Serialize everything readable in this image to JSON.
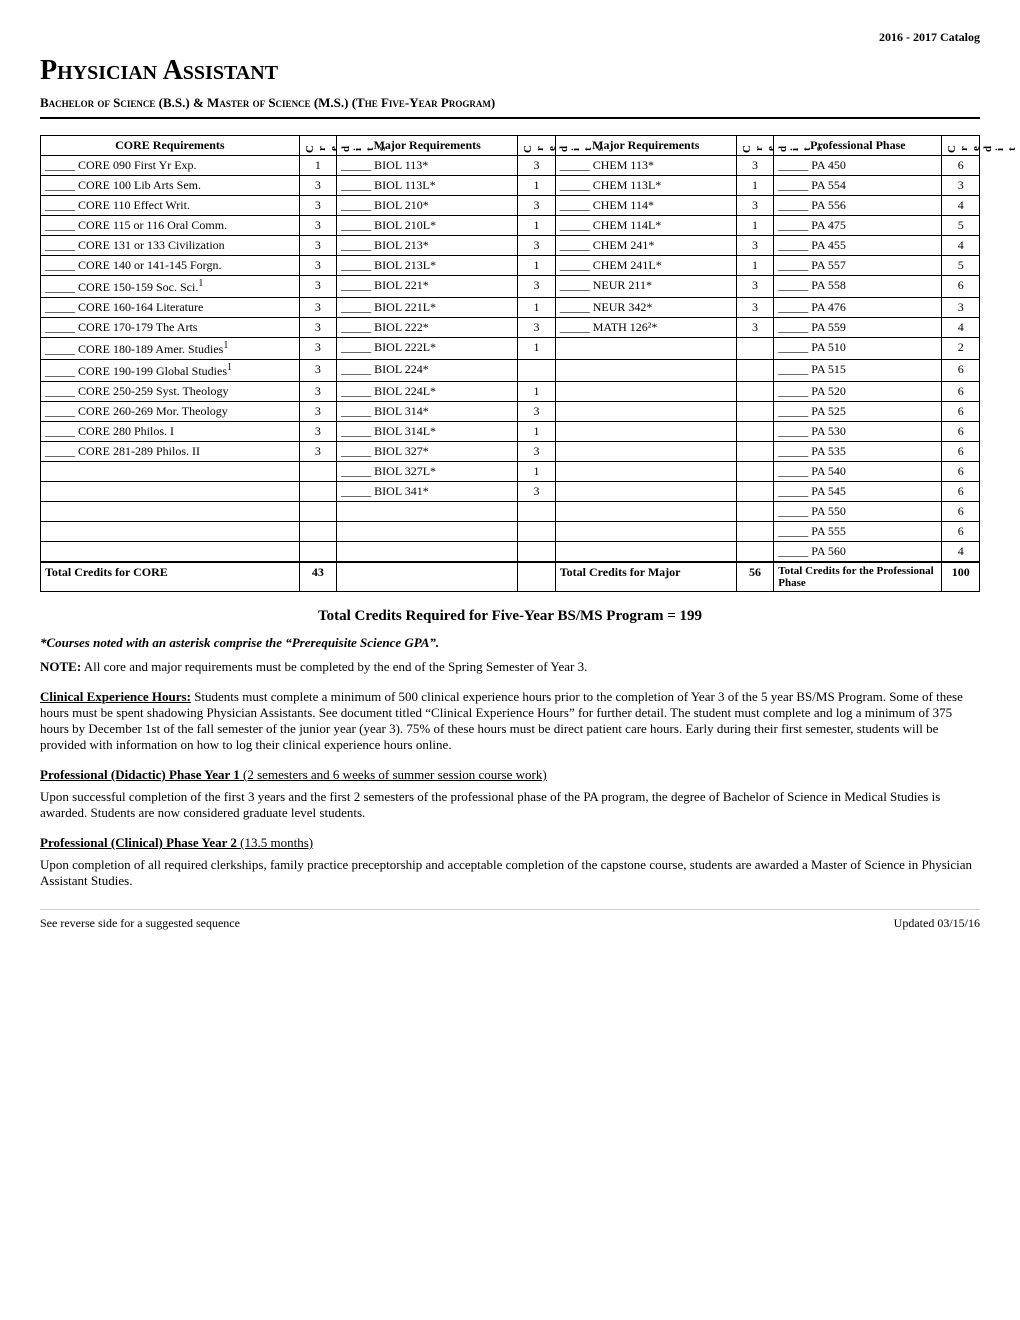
{
  "catalog_year": "2016 - 2017 Catalog",
  "page_title": "Physician Assistant",
  "subtitle": "Bachelor of Science (B.S.) & Master of Science (M.S.) (The Five-Year Program)",
  "table": {
    "headers": {
      "core": "CORE Requirements",
      "credits_label": "Credits",
      "major1": "Major Requirements",
      "major2": "Major Requirements",
      "professional": "Professional Phase"
    },
    "core_rows": [
      {
        "name": "CORE 090 First Yr Exp.",
        "credits": "1"
      },
      {
        "name": "CORE 100 Lib Arts Sem.",
        "credits": "3"
      },
      {
        "name": "CORE 110 Effect Writ.",
        "credits": "3"
      },
      {
        "name": "CORE 115 or 116 Oral Comm.",
        "credits": "3"
      },
      {
        "name": "CORE 131 or 133 Civilization",
        "credits": "3"
      },
      {
        "name": "CORE 140 or 141-145 Forgn.",
        "credits": "3"
      },
      {
        "name": "CORE 150-159 Soc. Sci.",
        "sup": "1",
        "credits": "3"
      },
      {
        "name": "CORE 160-164 Literature",
        "credits": "3"
      },
      {
        "name": "CORE 170-179 The Arts",
        "credits": "3"
      },
      {
        "name": "CORE 180-189 Amer. Studies",
        "sup": "1",
        "credits": "3"
      },
      {
        "name": "CORE 190-199 Global Studies",
        "sup": "1",
        "credits": "3"
      },
      {
        "name": "CORE 250-259 Syst. Theology",
        "credits": "3"
      },
      {
        "name": "CORE 260-269 Mor. Theology",
        "credits": "3"
      },
      {
        "name": "CORE 280 Philos. I",
        "credits": "3"
      },
      {
        "name": "CORE 281-289 Philos. II",
        "credits": "3"
      }
    ],
    "core_total": "43",
    "major1_rows": [
      {
        "name": "BIOL 113*",
        "credits": "3"
      },
      {
        "name": "BIOL 113L*",
        "credits": "1"
      },
      {
        "name": "BIOL 210*",
        "credits": "3"
      },
      {
        "name": "BIOL 210L*",
        "credits": "1"
      },
      {
        "name": "BIOL 213*",
        "credits": "3"
      },
      {
        "name": "BIOL 213L*",
        "credits": "1"
      },
      {
        "name": "BIOL 221*",
        "credits": "3"
      },
      {
        "name": "BIOL 221L*",
        "credits": "1"
      },
      {
        "name": "BIOL 222*",
        "credits": "3"
      },
      {
        "name": "BIOL 222L*",
        "credits": "1"
      },
      {
        "name": "BIOL 224*",
        "credits": ""
      },
      {
        "name": "BIOL 224L*",
        "credits": "1"
      },
      {
        "name": "BIOL 314*",
        "credits": "3"
      },
      {
        "name": "BIOL 314L*",
        "credits": "1"
      },
      {
        "name": "BIOL 327*",
        "credits": "3"
      },
      {
        "name": "BIOL 327L*",
        "credits": "1"
      },
      {
        "name": "BIOL 341*",
        "credits": "3"
      }
    ],
    "major2_rows": [
      {
        "name": "CHEM 113*",
        "credits": "3"
      },
      {
        "name": "CHEM 113L*",
        "credits": "1"
      },
      {
        "name": "CHEM 114*",
        "credits": "3"
      },
      {
        "name": "CHEM 114L*",
        "credits": "1"
      },
      {
        "name": "CHEM 241*",
        "credits": "3"
      },
      {
        "name": "CHEM 241L*",
        "credits": "1"
      },
      {
        "name": "NEUR 211*",
        "credits": "3"
      },
      {
        "name": "NEUR 342*",
        "credits": "3"
      },
      {
        "name": "MATH 126²*",
        "credits": "3"
      }
    ],
    "major_total": "56",
    "prof_rows": [
      {
        "name": "PA 450",
        "credits": "6"
      },
      {
        "name": "PA 554",
        "credits": "3"
      },
      {
        "name": "PA 556",
        "credits": "4"
      },
      {
        "name": "PA 475",
        "credits": "5"
      },
      {
        "name": "PA 455",
        "credits": "4"
      },
      {
        "name": "PA 557",
        "credits": "5"
      },
      {
        "name": "PA 558",
        "credits": "6"
      },
      {
        "name": "PA 476",
        "credits": "3"
      },
      {
        "name": "PA 559",
        "credits": "4"
      },
      {
        "name": "PA 510",
        "credits": "2"
      },
      {
        "name": "PA 515",
        "credits": "6"
      },
      {
        "name": "PA 520",
        "credits": "6"
      },
      {
        "name": "PA 525",
        "credits": "6"
      },
      {
        "name": "PA 530",
        "credits": "6"
      },
      {
        "name": "PA 535",
        "credits": "6"
      },
      {
        "name": "PA 540",
        "credits": "6"
      },
      {
        "name": "PA 545",
        "credits": "6"
      },
      {
        "name": "PA 550",
        "credits": "6"
      },
      {
        "name": "PA 555",
        "credits": "6"
      },
      {
        "name": "PA 560",
        "credits": "4"
      }
    ],
    "prof_total": "100",
    "prof_total_label": "Total Credits for the Professional Phase"
  },
  "total_credits_heading": "Total Credits Required for Five-Year BS/MS Program = 199",
  "asterisk_note": "*Courses noted with an asterisk comprise the “Prerequisite Science GPA”.",
  "note_label": "NOTE:",
  "note_text": "All core and major requirements must be completed by the end of the Spring Semester of Year 3.",
  "clinical_title": "Clinical Experience Hours:",
  "clinical_text": "Students must complete a minimum of 500 clinical experience hours prior to the completion of Year 3 of the 5 year BS/MS Program. Some of these hours must be spent shadowing Physician Assistants. See document titled “Clinical Experience Hours” for further detail. The student must complete and log a minimum of 375 hours by December 1st of the fall semester of the junior year (year 3). 75% of these hours must be direct patient care hours. Early during their first semester, students will be provided with information on how to log their clinical experience hours online.",
  "phase1_heading": "Professional (Didactic) Phase Year 1",
  "phase1_subheading": "(2 semesters and 6 weeks of summer session course work)",
  "phase1_text": "Upon successful completion of the first 3 years and the first 2 semesters of the professional phase of the PA program, the degree of Bachelor of Science in Medical Studies is awarded. Students are now considered graduate level students.",
  "phase2_heading": "Professional (Clinical) Phase Year 2",
  "phase2_subheading": "(13.5 months)",
  "phase2_text": "Upon completion of all required clerkships, family practice preceptorship and acceptable completion of the capstone course, students are awarded a Master of Science in Physician Assistant Studies.",
  "footer_left": "See reverse side for a suggested sequence",
  "footer_right": "Updated 03/15/16"
}
